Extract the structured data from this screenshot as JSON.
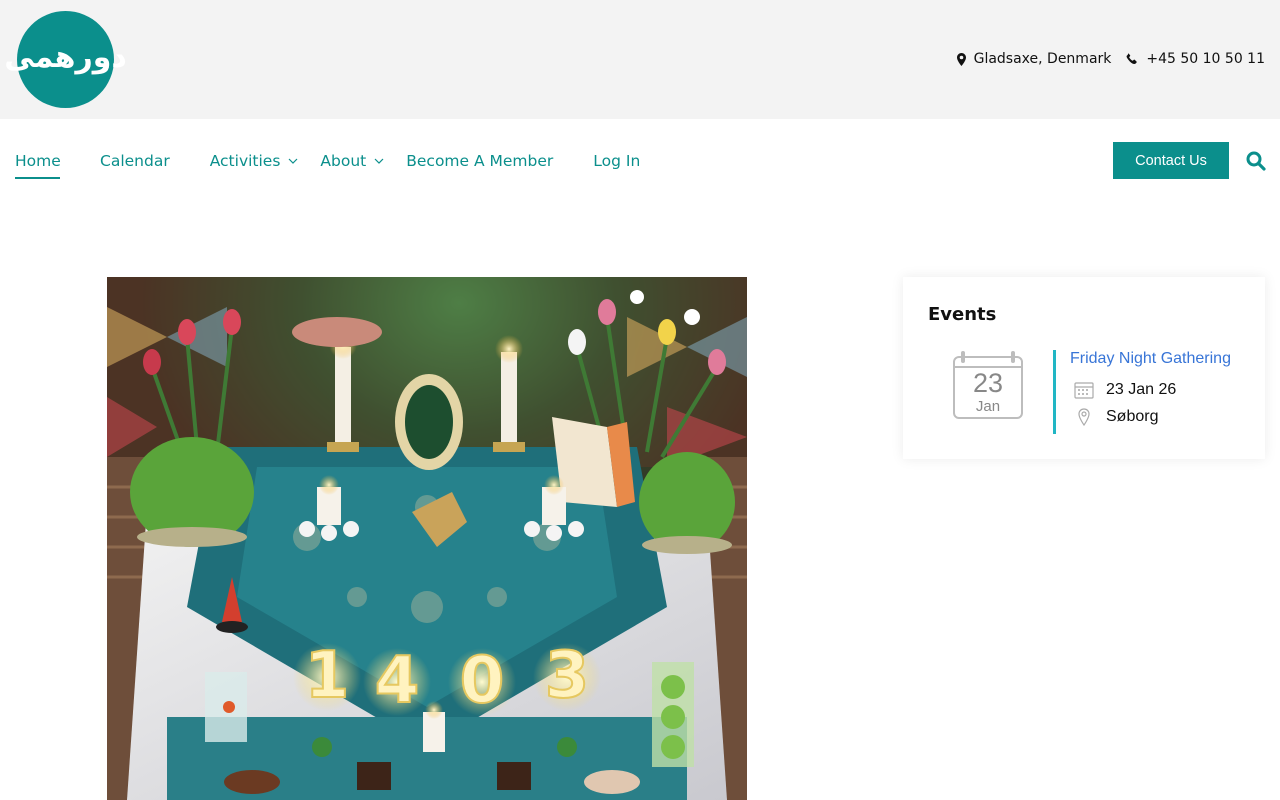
{
  "header": {
    "logo_text": "دورهمی",
    "location": "Gladsaxe, Denmark",
    "phone": "+45 50 10 50 11"
  },
  "nav": {
    "items": [
      {
        "label": "Home"
      },
      {
        "label": "Calendar"
      },
      {
        "label": "Activities"
      },
      {
        "label": "About"
      },
      {
        "label": "Become A Member"
      },
      {
        "label": "Log In"
      }
    ],
    "contact_label": "Contact Us"
  },
  "colors": {
    "brand": "#0b8f8c",
    "link": "#3875d7",
    "divider": "#21b6c4",
    "topbar": "#f3f3f3"
  },
  "icons": {
    "location": "map-marker-icon",
    "phone": "phone-icon",
    "search": "search-icon",
    "calendar": "calendar-icon",
    "pin": "location-pin-icon",
    "chevron": "chevron-down-icon"
  },
  "hero": {
    "lights": [
      "1",
      "4",
      "0",
      "3"
    ]
  },
  "events": {
    "title": "Events",
    "list": [
      {
        "day": "23",
        "month": "Jan",
        "name": "Friday Night Gathering",
        "date": "23 Jan 26",
        "place": "Søborg"
      }
    ]
  }
}
